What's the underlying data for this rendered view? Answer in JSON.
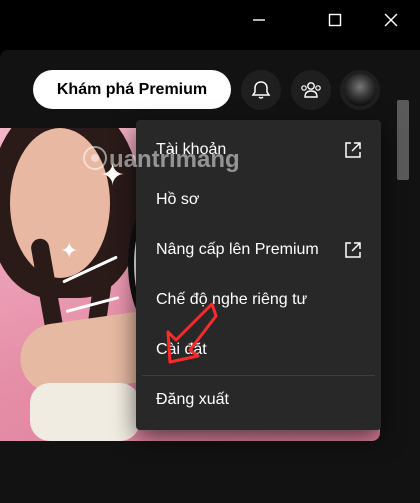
{
  "window": {
    "controls": [
      "minimize-icon",
      "maximize-icon",
      "close-icon"
    ]
  },
  "header": {
    "premium_label": "Khám phá Premium",
    "icons": [
      "bell-icon",
      "friends-icon",
      "avatar"
    ]
  },
  "menu": {
    "items": [
      {
        "label": "Tài khoản",
        "icon": "external-link-icon"
      },
      {
        "label": "Hồ sơ"
      },
      {
        "label": "Nâng cấp lên Premium",
        "icon": "external-link-icon"
      },
      {
        "label": "Chế độ nghe riêng tư"
      },
      {
        "label": "Cài đặt"
      },
      {
        "label": "Đăng xuất"
      }
    ]
  },
  "watermark": {
    "text": "uantrimang"
  },
  "colors": {
    "background": "#000000",
    "menu_bg": "#282828",
    "premium_bg": "#ffffff",
    "annotation_arrow": "#ff2a2a"
  }
}
